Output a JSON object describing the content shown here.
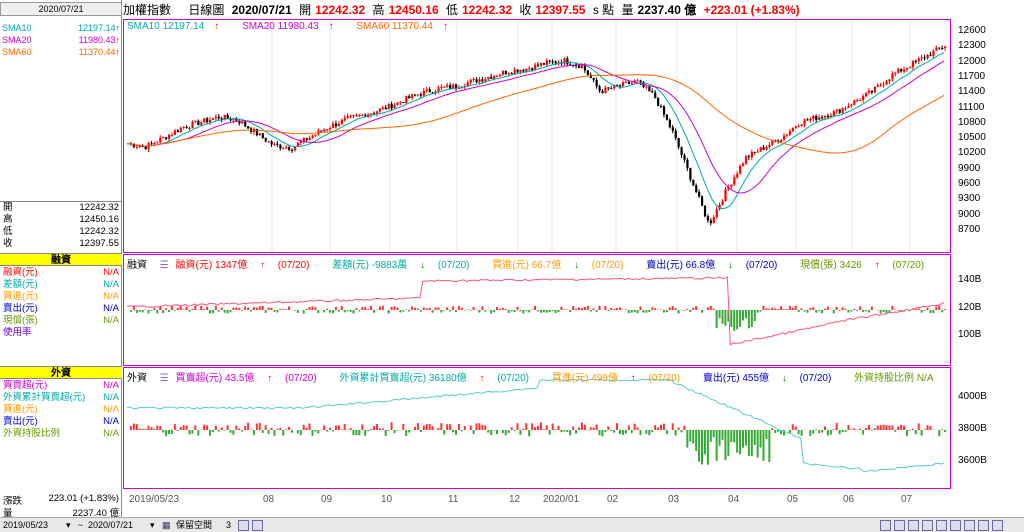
{
  "side": {
    "date": "2020/07/21",
    "sma": [
      {
        "k": "SMA10",
        "v": "12197.14",
        "arrow": "↑",
        "color": "#00aaaa"
      },
      {
        "k": "SMA20",
        "v": "11980.43",
        "arrow": "↑",
        "color": "#cc00cc"
      },
      {
        "k": "SMA60",
        "v": "11370.44",
        "arrow": "↑",
        "color": "#ff6600"
      }
    ],
    "ohlc": [
      {
        "k": "開",
        "v": "12242.32"
      },
      {
        "k": "高",
        "v": "12450.16"
      },
      {
        "k": "低",
        "v": "12242.32"
      },
      {
        "k": "收",
        "v": "12397.55"
      }
    ],
    "margin_title": "融資",
    "margin_rows": [
      {
        "k": "融資(元)",
        "v": "N/A",
        "color": "#ff0000"
      },
      {
        "k": "差額(元)",
        "v": "N/A",
        "color": "#00aaaa"
      },
      {
        "k": "買進(元)",
        "v": "N/A",
        "color": "#ff9900"
      },
      {
        "k": "賣出(元)",
        "v": "N/A",
        "color": "#0000cc"
      },
      {
        "k": "現償(張)",
        "v": "N/A",
        "color": "#669900"
      },
      {
        "k": "使用率",
        "v": "",
        "color": "#6600cc"
      }
    ],
    "foreign_title": "外資",
    "foreign_rows": [
      {
        "k": "買賣超(元)",
        "v": "N/A",
        "color": "#cc00cc"
      },
      {
        "k": "外資累計買賣超(元)",
        "v": "N/A",
        "color": "#00aaaa"
      },
      {
        "k": "買進(元)",
        "v": "N/A",
        "color": "#ff9900"
      },
      {
        "k": "賣出(元)",
        "v": "N/A",
        "color": "#0000cc"
      },
      {
        "k": "外資持股比例",
        "v": "N/A",
        "color": "#669900"
      }
    ],
    "foot": [
      {
        "k": "漲跌",
        "v": "223.01 (+1.83%)"
      },
      {
        "k": "量",
        "v": "2237.40 億"
      }
    ]
  },
  "topbar": {
    "name": "加權指數",
    "period": "日線圖",
    "date": "2020/07/21",
    "open_lbl": "開",
    "open": "12242.32",
    "high_lbl": "高",
    "high": "12450.16",
    "low_lbl": "低",
    "low": "12242.32",
    "close_lbl": "收",
    "close": "12397.55",
    "unit": "s 點",
    "vol_lbl": "量",
    "vol": "2237.40 億",
    "change": "+223.01 (+1.83%)"
  },
  "legends": {
    "price": [
      {
        "text": "SMA10 12197.14",
        "arrow": "↑",
        "color": "#00aaaa"
      },
      {
        "text": "SMA20 11980.43",
        "arrow": "↑",
        "color": "#cc00cc"
      },
      {
        "text": "SMA60 11370.44",
        "arrow": "↑",
        "color": "#ff6600"
      }
    ],
    "margin": [
      {
        "text": "融資",
        "color": "#000000"
      },
      {
        "text": "融資(元) 1347億",
        "arrow": "↑",
        "date": "(07/20)",
        "color": "#ff0000"
      },
      {
        "text": "差額(元) -9883萬",
        "arrow": "↓",
        "date": "(07/20)",
        "color": "#00aaaa"
      },
      {
        "text": "買進(元) 66.7億",
        "arrow": "↓",
        "date": "(07/20)",
        "color": "#ff9900"
      },
      {
        "text": "賣出(元) 66.8億",
        "arrow": "↓",
        "date": "(07/20)",
        "color": "#0000cc"
      },
      {
        "text": "現償(張) 3426",
        "arrow": "↑",
        "date": "(07/20)",
        "color": "#669900"
      }
    ],
    "foreign": [
      {
        "text": "外資",
        "color": "#000000"
      },
      {
        "text": "買賣超(元) 43.5億",
        "arrow": "↑",
        "date": "(07/20)",
        "color": "#cc00cc"
      },
      {
        "text": "外資累計買賣超(元) 36180億",
        "arrow": "↑",
        "date": "(07/20)",
        "color": "#00aaaa"
      },
      {
        "text": "買進(元) 499億",
        "arrow": "↑",
        "date": "(07/20)",
        "color": "#ff9900"
      },
      {
        "text": "賣出(元) 455億",
        "arrow": "↓",
        "date": "(07/20)",
        "color": "#0000cc"
      },
      {
        "text": "外資持股比例 N/A",
        "color": "#669900"
      }
    ]
  },
  "axes": {
    "price_ticks": [
      "12600",
      "12300",
      "12000",
      "11700",
      "11400",
      "11100",
      "10800",
      "10500",
      "10200",
      "9900",
      "9600",
      "9300",
      "9000",
      "8700"
    ],
    "margin_ticks": [
      "140B",
      "120B",
      "100B"
    ],
    "foreign_ticks": [
      "4000B",
      "3800B",
      "3600B"
    ],
    "x_labels": [
      "2019/05/23",
      "08",
      "09",
      "10",
      "11",
      "12",
      "2020/01",
      "02",
      "03",
      "04",
      "05",
      "06",
      "07"
    ]
  },
  "bottombar": {
    "range_start": "2019/05/23",
    "range_sep": "~",
    "range_end": "2020/07/21",
    "save_label": "保留空間",
    "save_value": "3"
  },
  "chart_data": {
    "type": "line",
    "title": "",
    "ylim": [
      8500,
      12700
    ],
    "x_months": [
      "2019/05/23",
      "08",
      "09",
      "10",
      "11",
      "12",
      "2020/01",
      "02",
      "03",
      "04",
      "05",
      "06",
      "07"
    ],
    "close_approx": [
      10480,
      10420,
      10600,
      10800,
      10900,
      11000,
      10950,
      10700,
      10450,
      10400,
      10600,
      10800,
      10950,
      11050,
      11150,
      11300,
      11450,
      11550,
      11600,
      11700,
      11800,
      11900,
      11950,
      12050,
      12100,
      12000,
      11500,
      11600,
      11700,
      11400,
      10700,
      9800,
      8900,
      9600,
      10200,
      10400,
      10600,
      10900,
      11000,
      11100,
      11300,
      11500,
      11800,
      12000,
      12200,
      12400
    ]
  }
}
